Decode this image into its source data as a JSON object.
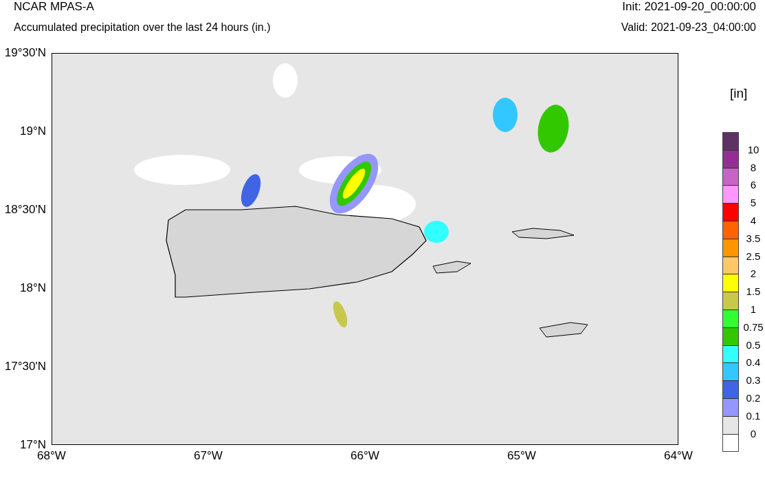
{
  "title": "NCAR MPAS-A",
  "subtitle": "Accumulated precipitation over the last 24 hours (in.)",
  "init": "Init: 2021-09-20_00:00:00",
  "valid": "Valid: 2021-09-23_04:00:00",
  "y_axis": [
    "19°30'N",
    "19°N",
    "18°30'N",
    "18°N",
    "17°30'N",
    "17°N"
  ],
  "x_axis": [
    "68°W",
    "67°W",
    "66°W",
    "65°W",
    "64°W"
  ],
  "colorbar": {
    "unit": "[in]",
    "boxes": [
      {
        "color": "#5e3364"
      },
      {
        "color": "#962d96"
      },
      {
        "color": "#c864c8"
      },
      {
        "color": "#ff96ff"
      },
      {
        "color": "#ff0000"
      },
      {
        "color": "#ff6400"
      },
      {
        "color": "#ff9600"
      },
      {
        "color": "#ffc864"
      },
      {
        "color": "#ffff00"
      },
      {
        "color": "#c8c84b"
      },
      {
        "color": "#32ff32"
      },
      {
        "color": "#32c800"
      },
      {
        "color": "#32ffff"
      },
      {
        "color": "#32c8ff"
      },
      {
        "color": "#4164e6"
      },
      {
        "color": "#9696ff"
      },
      {
        "color": "#e6e6e6"
      },
      {
        "color": "#ffffff"
      }
    ],
    "labels": [
      "10",
      "8",
      "6",
      "5",
      "4",
      "3.5",
      "2.5",
      "2",
      "1.5",
      "1",
      "0.75",
      "0.5",
      "0.4",
      "0.3",
      "0.2",
      "0.1",
      "0"
    ]
  }
}
